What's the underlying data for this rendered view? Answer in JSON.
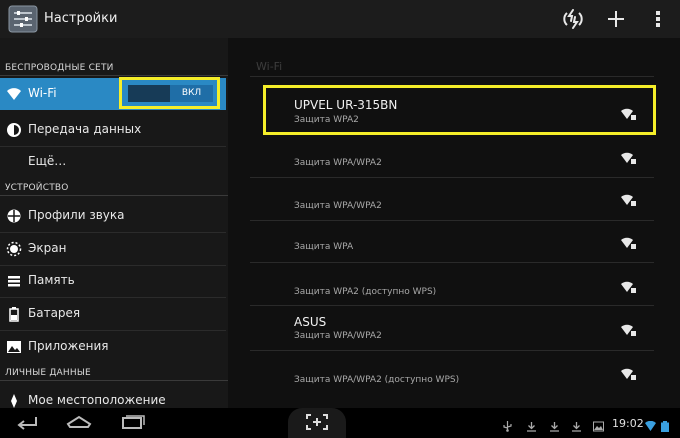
{
  "action_bar": {
    "title": "Настройки"
  },
  "sidebar": {
    "sections": [
      {
        "label": "БЕСПРОВОДНЫЕ СЕТИ"
      },
      {
        "label": "УСТРОЙСТВО"
      },
      {
        "label": "ЛИЧНЫЕ ДАННЫЕ"
      }
    ],
    "items": [
      {
        "label": "Wi-Fi",
        "icon": "wifi-icon"
      },
      {
        "label": "Передача данных",
        "icon": "data-usage-icon"
      },
      {
        "label": "Ещё…",
        "icon": ""
      },
      {
        "label": "Профили звука",
        "icon": "sound-icon"
      },
      {
        "label": "Экран",
        "icon": "display-icon"
      },
      {
        "label": "Память",
        "icon": "storage-icon"
      },
      {
        "label": "Батарея",
        "icon": "battery-icon"
      },
      {
        "label": "Приложения",
        "icon": "apps-icon"
      },
      {
        "label": "Мое местоположение",
        "icon": "location-icon"
      }
    ],
    "wifi_toggle": {
      "state_label": "ВКЛ",
      "on": true
    }
  },
  "content": {
    "title": "Wi-Fi",
    "networks": [
      {
        "name": "UPVEL UR-315BN",
        "security": "Защита WPA2"
      },
      {
        "name": "",
        "security": "Защита WPA/WPA2"
      },
      {
        "name": "",
        "security": "Защита WPA/WPA2"
      },
      {
        "name": "",
        "security": "Защита WPA"
      },
      {
        "name": "",
        "security": "Защита WPA2 (доступно WPS)"
      },
      {
        "name": "ASUS",
        "security": "Защита WPA/WPA2"
      },
      {
        "name": "",
        "security": "Защита WPA/WPA2 (доступно WPS)"
      }
    ]
  },
  "status_bar": {
    "time": "19:02"
  },
  "colors": {
    "accent": "#2a89c4",
    "highlight": "#f5ee29"
  }
}
